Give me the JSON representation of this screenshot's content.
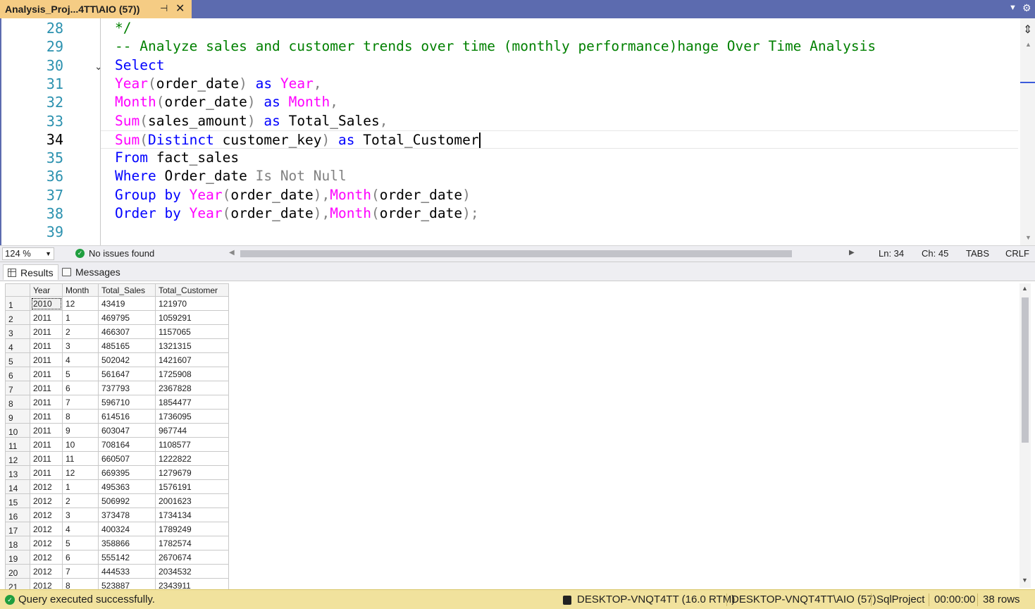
{
  "tab": {
    "title": "Analysis_Proj...4TT\\AIO (57))",
    "pin_glyph": "⊣",
    "close_glyph": "✕"
  },
  "editor": {
    "line_numbers": [
      "28",
      "29",
      "30",
      "31",
      "32",
      "33",
      "34",
      "35",
      "36",
      "37",
      "38",
      "39"
    ],
    "lines": [
      [
        {
          "t": "*/",
          "c": "cm"
        }
      ],
      [
        {
          "t": "-- Analyze sales and customer trends over time (monthly performance)hange Over Time Analysis",
          "c": "cm"
        }
      ],
      [
        {
          "t": "Select",
          "c": "kw"
        }
      ],
      [
        {
          "t": "Year",
          "c": "fn"
        },
        {
          "t": "(",
          "c": "gr"
        },
        {
          "t": "order_date",
          "c": "tx"
        },
        {
          "t": ")",
          "c": "gr"
        },
        {
          "t": " as ",
          "c": "kw"
        },
        {
          "t": "Year",
          "c": "fn"
        },
        {
          "t": ",",
          "c": "gr"
        }
      ],
      [
        {
          "t": "Month",
          "c": "fn"
        },
        {
          "t": "(",
          "c": "gr"
        },
        {
          "t": "order_date",
          "c": "tx"
        },
        {
          "t": ")",
          "c": "gr"
        },
        {
          "t": " as ",
          "c": "kw"
        },
        {
          "t": "Month",
          "c": "fn"
        },
        {
          "t": ",",
          "c": "gr"
        }
      ],
      [
        {
          "t": "Sum",
          "c": "fn"
        },
        {
          "t": "(",
          "c": "gr"
        },
        {
          "t": "sales_amount",
          "c": "tx"
        },
        {
          "t": ")",
          "c": "gr"
        },
        {
          "t": " as ",
          "c": "kw"
        },
        {
          "t": "Total_Sales",
          "c": "tx"
        },
        {
          "t": ",",
          "c": "gr"
        }
      ],
      [
        {
          "t": "Sum",
          "c": "fn"
        },
        {
          "t": "(",
          "c": "gr"
        },
        {
          "t": "Distinct",
          "c": "kw"
        },
        {
          "t": " customer_key",
          "c": "tx"
        },
        {
          "t": ")",
          "c": "gr"
        },
        {
          "t": " as ",
          "c": "kw"
        },
        {
          "t": "Total_Customer",
          "c": "tx"
        }
      ],
      [
        {
          "t": "From",
          "c": "kw"
        },
        {
          "t": " fact_sales",
          "c": "tx"
        }
      ],
      [
        {
          "t": "Where",
          "c": "kw"
        },
        {
          "t": " Order_date ",
          "c": "tx"
        },
        {
          "t": "Is Not Null",
          "c": "gr"
        }
      ],
      [
        {
          "t": "Group by ",
          "c": "kw"
        },
        {
          "t": "Year",
          "c": "fn"
        },
        {
          "t": "(",
          "c": "gr"
        },
        {
          "t": "order_date",
          "c": "tx"
        },
        {
          "t": "),",
          "c": "gr"
        },
        {
          "t": "Month",
          "c": "fn"
        },
        {
          "t": "(",
          "c": "gr"
        },
        {
          "t": "order_date",
          "c": "tx"
        },
        {
          "t": ")",
          "c": "gr"
        }
      ],
      [
        {
          "t": "Order by ",
          "c": "kw"
        },
        {
          "t": "Year",
          "c": "fn"
        },
        {
          "t": "(",
          "c": "gr"
        },
        {
          "t": "order_date",
          "c": "tx"
        },
        {
          "t": "),",
          "c": "gr"
        },
        {
          "t": "Month",
          "c": "fn"
        },
        {
          "t": "(",
          "c": "gr"
        },
        {
          "t": "order_date",
          "c": "tx"
        },
        {
          "t": ");",
          "c": "gr"
        }
      ],
      []
    ],
    "current_line_index": 6
  },
  "editor_status": {
    "zoom": "124 %",
    "issues": "No issues found",
    "line": "Ln: 34",
    "col": "Ch: 45",
    "indent": "TABS",
    "eol": "CRLF"
  },
  "results_tabs": {
    "results": "Results",
    "messages": "Messages"
  },
  "grid": {
    "columns": [
      "Year",
      "Month",
      "Total_Sales",
      "Total_Customer"
    ],
    "rows": [
      [
        "1",
        "2010",
        "12",
        "43419",
        "121970"
      ],
      [
        "2",
        "2011",
        "1",
        "469795",
        "1059291"
      ],
      [
        "3",
        "2011",
        "2",
        "466307",
        "1157065"
      ],
      [
        "4",
        "2011",
        "3",
        "485165",
        "1321315"
      ],
      [
        "5",
        "2011",
        "4",
        "502042",
        "1421607"
      ],
      [
        "6",
        "2011",
        "5",
        "561647",
        "1725908"
      ],
      [
        "7",
        "2011",
        "6",
        "737793",
        "2367828"
      ],
      [
        "8",
        "2011",
        "7",
        "596710",
        "1854477"
      ],
      [
        "9",
        "2011",
        "8",
        "614516",
        "1736095"
      ],
      [
        "10",
        "2011",
        "9",
        "603047",
        "967744"
      ],
      [
        "11",
        "2011",
        "10",
        "708164",
        "1108577"
      ],
      [
        "12",
        "2011",
        "11",
        "660507",
        "1222822"
      ],
      [
        "13",
        "2011",
        "12",
        "669395",
        "1279679"
      ],
      [
        "14",
        "2012",
        "1",
        "495363",
        "1576191"
      ],
      [
        "15",
        "2012",
        "2",
        "506992",
        "2001623"
      ],
      [
        "16",
        "2012",
        "3",
        "373478",
        "1734134"
      ],
      [
        "17",
        "2012",
        "4",
        "400324",
        "1789249"
      ],
      [
        "18",
        "2012",
        "5",
        "358866",
        "1782574"
      ],
      [
        "19",
        "2012",
        "6",
        "555142",
        "2670674"
      ],
      [
        "20",
        "2012",
        "7",
        "444533",
        "2034532"
      ],
      [
        "21",
        "2012",
        "8",
        "523887",
        "2343911"
      ]
    ]
  },
  "statusbar": {
    "message": "Query executed successfully.",
    "server": "DESKTOP-VNQT4TT (16.0 RTM)",
    "connection": "DESKTOP-VNQT4TT\\AIO (57)",
    "database": "SqlProject",
    "elapsed": "00:00:00",
    "rows": "38 rows"
  },
  "colors": {
    "tab_active": "#f5cc84",
    "tab_strip": "#5c6baf",
    "statusbar": "#f1e29d",
    "keyword": "#0000ff",
    "function": "#ff00ff",
    "comment": "#008000",
    "line_number": "#2b91af"
  }
}
